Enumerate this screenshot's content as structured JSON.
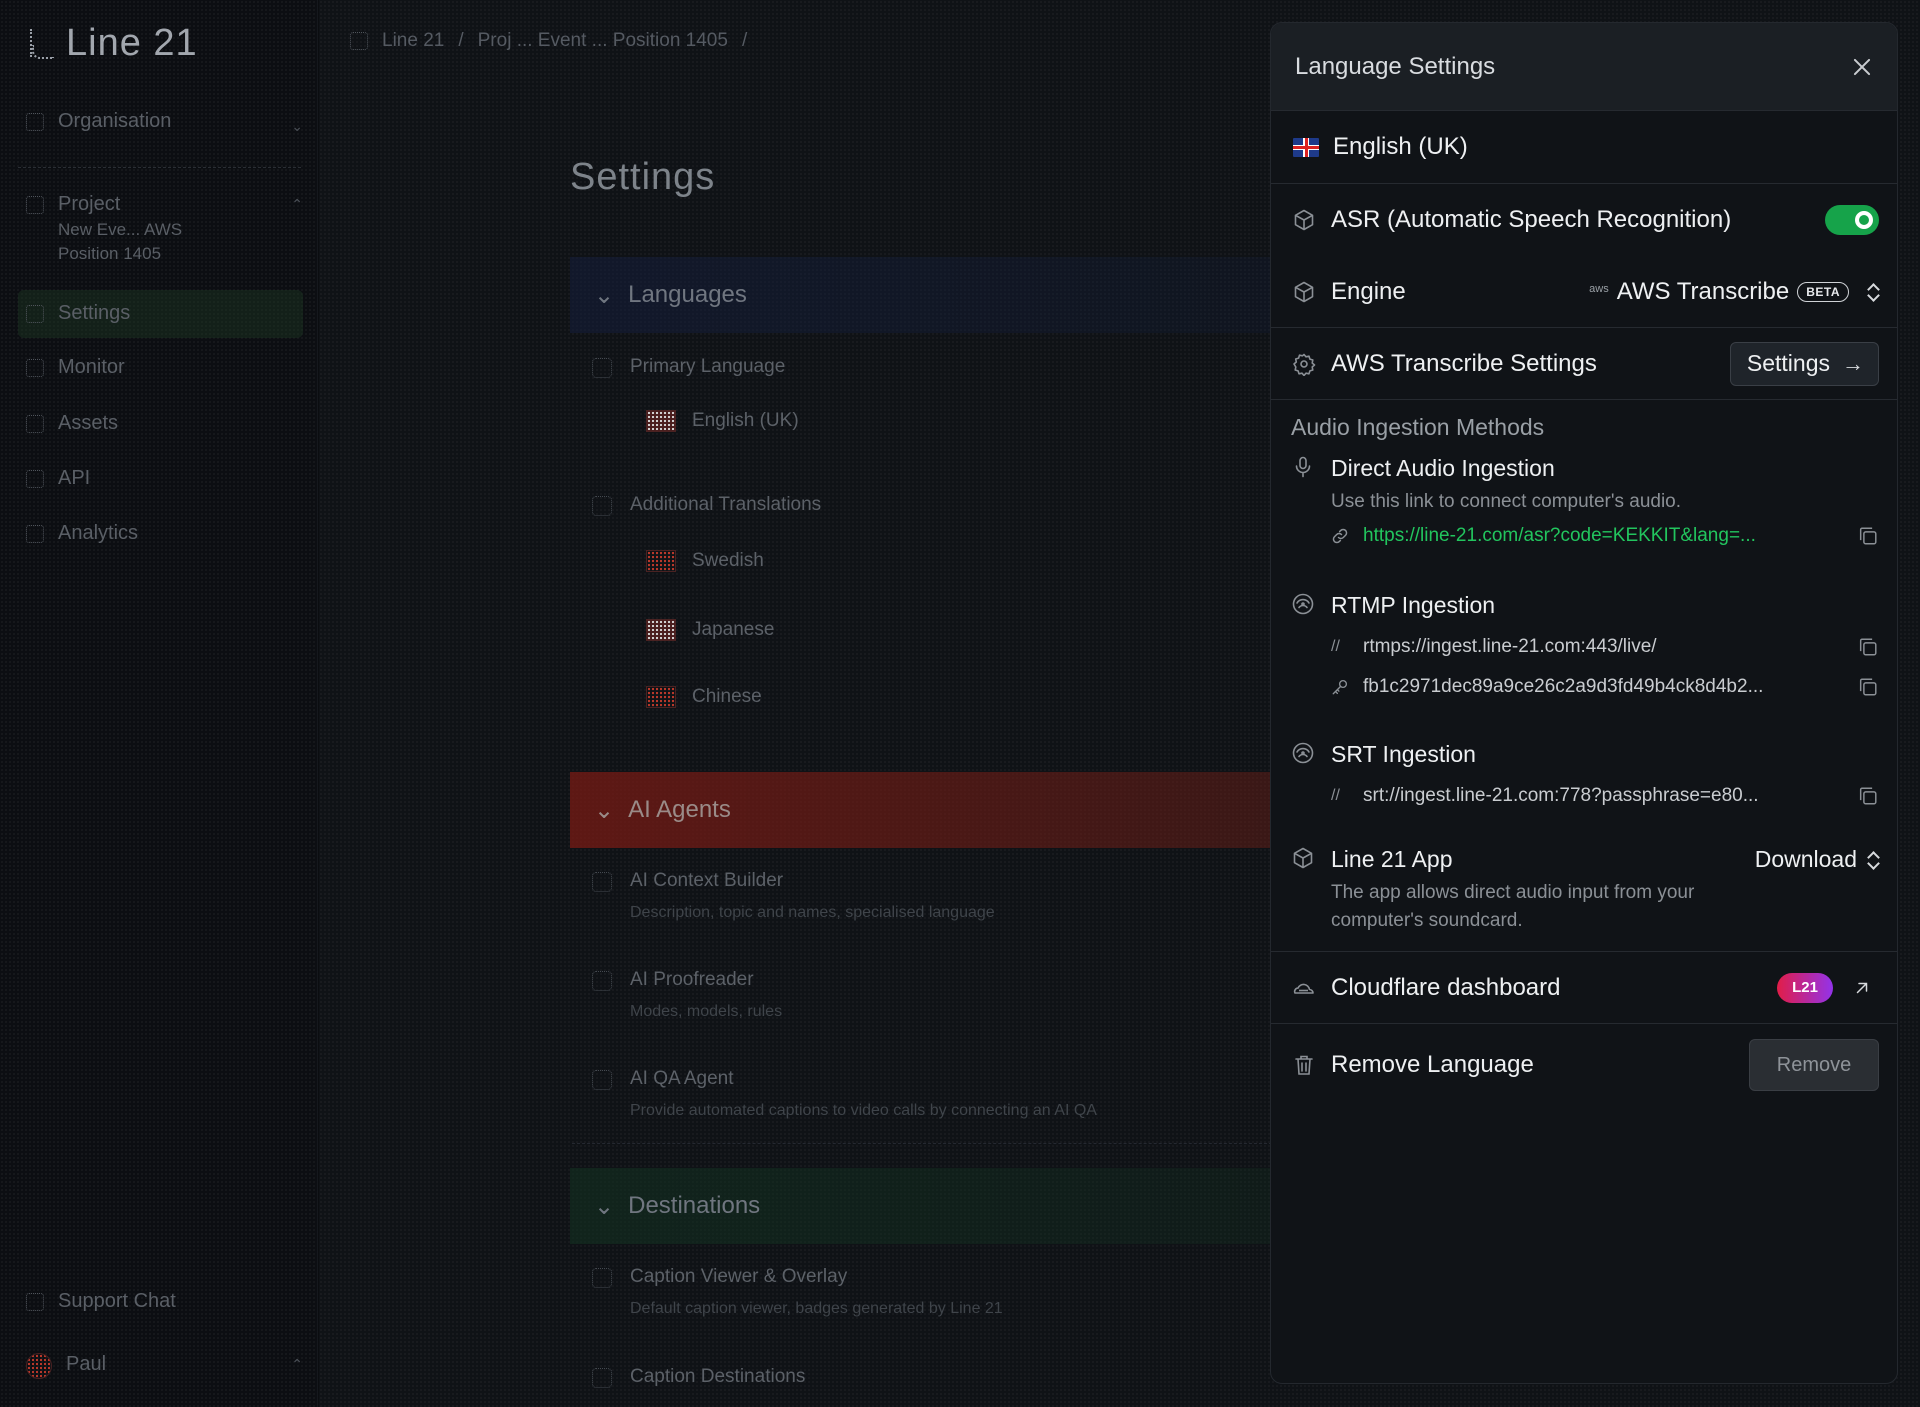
{
  "app": {
    "logo_text": "Line 21"
  },
  "sidebar": {
    "items": [
      {
        "label": "Organisation"
      },
      {
        "label": "Project",
        "sub1": "New Eve... AWS",
        "sub2": "Position 1405"
      },
      {
        "label": "Settings"
      },
      {
        "label": "Monitor"
      },
      {
        "label": "Assets"
      },
      {
        "label": "API"
      },
      {
        "label": "Analytics"
      }
    ],
    "footer": {
      "support": "Support Chat",
      "user": "Paul"
    }
  },
  "main": {
    "breadcrumb": [
      "Line 21",
      "/",
      "Proj ... Event ... Position 1405",
      "/"
    ],
    "title": "Settings",
    "sections": {
      "languages": "Languages",
      "ai_agents": "AI Agents",
      "destinations": "Destinations"
    },
    "primary_language_label": "Primary Language",
    "primary_language_value": "English (UK)",
    "additional_translations_label": "Additional Translations",
    "translations": [
      "Swedish",
      "Japanese",
      "Chinese"
    ],
    "ai_items": [
      {
        "title": "AI Context Builder",
        "sub": "Description, topic and names, specialised language"
      },
      {
        "title": "AI Proofreader",
        "sub": "Modes, models, rules"
      },
      {
        "title": "AI QA Agent",
        "sub": "Provide automated captions to video calls by connecting an AI QA"
      }
    ],
    "dest_items": [
      {
        "title": "Caption Viewer & Overlay",
        "sub": "Default caption viewer, badges generated by Line 21"
      },
      {
        "title": "Caption Destinations",
        "sub": ""
      }
    ]
  },
  "drawer": {
    "title": "Language Settings",
    "language": "English (UK)",
    "asr": {
      "label": "ASR (Automatic Speech Recognition)",
      "enabled": true
    },
    "engine": {
      "label": "Engine",
      "aws_mark": "aws",
      "value": "AWS Transcribe",
      "badge": "BETA"
    },
    "transcribe_settings": {
      "label": "AWS Transcribe Settings",
      "button": "Settings"
    },
    "ingestion": {
      "heading": "Audio Ingestion Methods",
      "direct": {
        "title": "Direct Audio Ingestion",
        "desc": "Use this link to connect computer's audio.",
        "link": "https://line-21.com/asr?code=KEKKIT&lang=..."
      },
      "rtmp": {
        "title": "RTMP Ingestion",
        "url": "rtmps://ingest.line-21.com:443/live/",
        "key": "fb1c2971dec89a9ce26c2a9d3fd49b4ck8d4b2..."
      },
      "srt": {
        "title": "SRT Ingestion",
        "url": "srt://ingest.line-21.com:778?passphrase=e80..."
      }
    },
    "app": {
      "title": "Line 21 App",
      "desc": "The app allows direct audio input from your computer's soundcard.",
      "action": "Download"
    },
    "cloudflare": {
      "label": "Cloudflare dashboard",
      "badge": "L21"
    },
    "remove": {
      "label": "Remove Language",
      "button": "Remove"
    },
    "colors": {
      "toggle_on": "#16a34a",
      "link": "#22c55e",
      "badge_from": "#e11d48",
      "badge_to": "#9333ea"
    }
  }
}
